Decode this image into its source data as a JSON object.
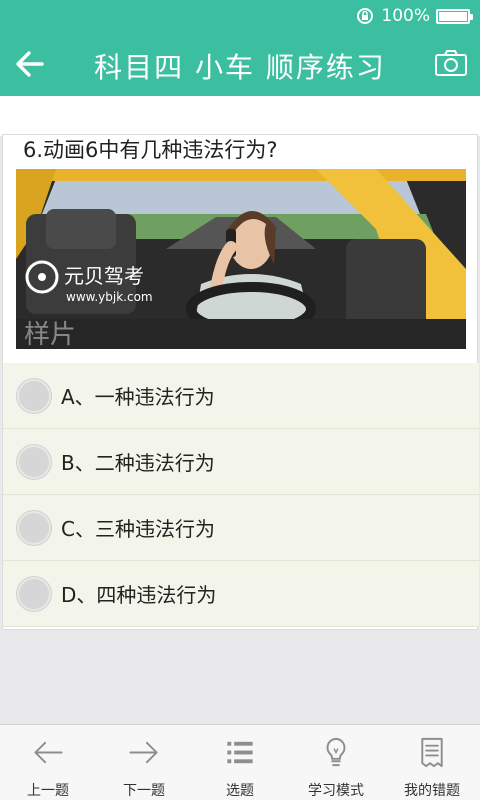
{
  "status": {
    "battery_text": "100%",
    "battery_level": 1.0
  },
  "header": {
    "title": "科目四 小车 顺序练习"
  },
  "question": {
    "text": "6.动画6中有几种违法行为?",
    "image": {
      "watermark_brand": "元贝驾考",
      "watermark_url": "www.ybjk.com",
      "sample_text": "样片"
    }
  },
  "options": [
    {
      "label": "A、一种违法行为"
    },
    {
      "label": "B、二种违法行为"
    },
    {
      "label": "C、三种违法行为"
    },
    {
      "label": "D、四种违法行为"
    }
  ],
  "tabbar": [
    {
      "label": "上一题",
      "icon": "arrow-left-icon"
    },
    {
      "label": "下一题",
      "icon": "arrow-right-icon"
    },
    {
      "label": "选题",
      "icon": "list-icon"
    },
    {
      "label": "学习模式",
      "icon": "lightbulb-icon"
    },
    {
      "label": "我的错题",
      "icon": "receipt-icon"
    }
  ],
  "colors": {
    "accent": "#3cbfa0",
    "option_bg": "#f4f5ea"
  }
}
